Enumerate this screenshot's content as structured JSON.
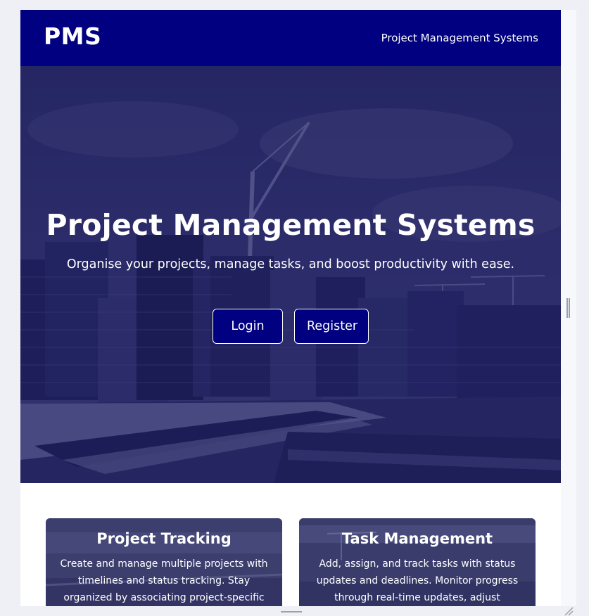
{
  "header": {
    "logo": "PMS",
    "nav_label": "Project Management Systems"
  },
  "hero": {
    "title": "Project Management Systems",
    "subtitle": "Organise your projects, manage tasks, and boost productivity with ease.",
    "login_label": "Login",
    "register_label": "Register"
  },
  "features": [
    {
      "title": "Project Tracking",
      "description": "Create and manage multiple projects with timelines and status tracking. Stay organized by associating project-specific"
    },
    {
      "title": "Task Management",
      "description": "Add, assign, and track tasks with status updates and deadlines. Monitor progress through real-time updates, adjust"
    }
  ],
  "colors": {
    "brand": "#000080",
    "text_on_brand": "#ffffff",
    "hero_overlay": "#14145a"
  }
}
